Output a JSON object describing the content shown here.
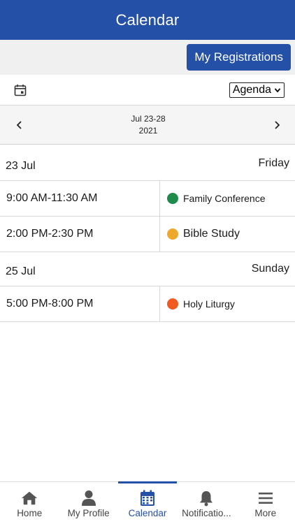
{
  "header": {
    "title": "Calendar"
  },
  "registrations": {
    "button_label": "My Registrations"
  },
  "toolbar": {
    "calendar_icon": "calendar-icon",
    "view_selected": "Agenda"
  },
  "navigation": {
    "range_line1": "Jul 23-28",
    "range_line2": "2021"
  },
  "agenda": {
    "days": [
      {
        "date": "23 Jul",
        "weekday": "Friday",
        "events": [
          {
            "time": "9:00 AM-11:30 AM",
            "title": "Family Conference",
            "color": "#1e8a4c"
          },
          {
            "time": "2:00 PM-2:30 PM",
            "title": "Bible Study",
            "color": "#f0a82a"
          }
        ]
      },
      {
        "date": "25 Jul",
        "weekday": "Sunday",
        "events": [
          {
            "time": "5:00 PM-8:00 PM",
            "title": "Holy Liturgy",
            "color": "#f05a22"
          }
        ]
      }
    ]
  },
  "tabbar": {
    "tabs": [
      {
        "label": "Home",
        "icon": "home-icon"
      },
      {
        "label": "My Profile",
        "icon": "person-icon"
      },
      {
        "label": "Calendar",
        "icon": "calendar-icon",
        "active": true
      },
      {
        "label": "Notificatio...",
        "icon": "bell-icon"
      },
      {
        "label": "More",
        "icon": "menu-icon"
      }
    ]
  },
  "colors": {
    "brand": "#2450a8",
    "background_bar": "#f0f0f0"
  }
}
